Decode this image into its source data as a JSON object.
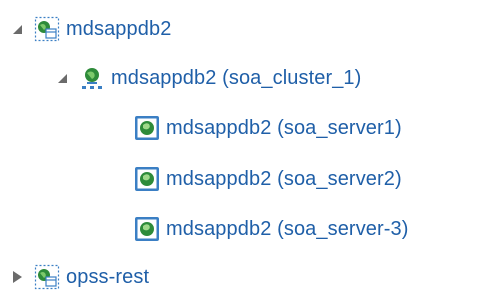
{
  "tree": {
    "nodes": [
      {
        "label": "mdsappdb2",
        "level": 0,
        "expanded": true,
        "icon": "datasource-icon",
        "toggle": "expanded-triangle-icon"
      },
      {
        "label": "mdsappdb2 (soa_cluster_1)",
        "level": 1,
        "expanded": true,
        "icon": "cluster-icon",
        "toggle": "expanded-triangle-icon"
      },
      {
        "label": "mdsappdb2 (soa_server1)",
        "level": 2,
        "icon": "server-globe-icon"
      },
      {
        "label": "mdsappdb2 (soa_server2)",
        "level": 2,
        "icon": "server-globe-icon"
      },
      {
        "label": "mdsappdb2 (soa_server-3)",
        "level": 2,
        "icon": "server-globe-icon"
      },
      {
        "label": "opss-rest",
        "level": 0,
        "expanded": false,
        "icon": "datasource-icon",
        "toggle": "collapsed-triangle-icon"
      }
    ]
  },
  "colors": {
    "link": "#1f5fa8",
    "toggle": "#6b6b6b",
    "globe": "#2e8b3a",
    "panel": "#3b7fc4"
  }
}
